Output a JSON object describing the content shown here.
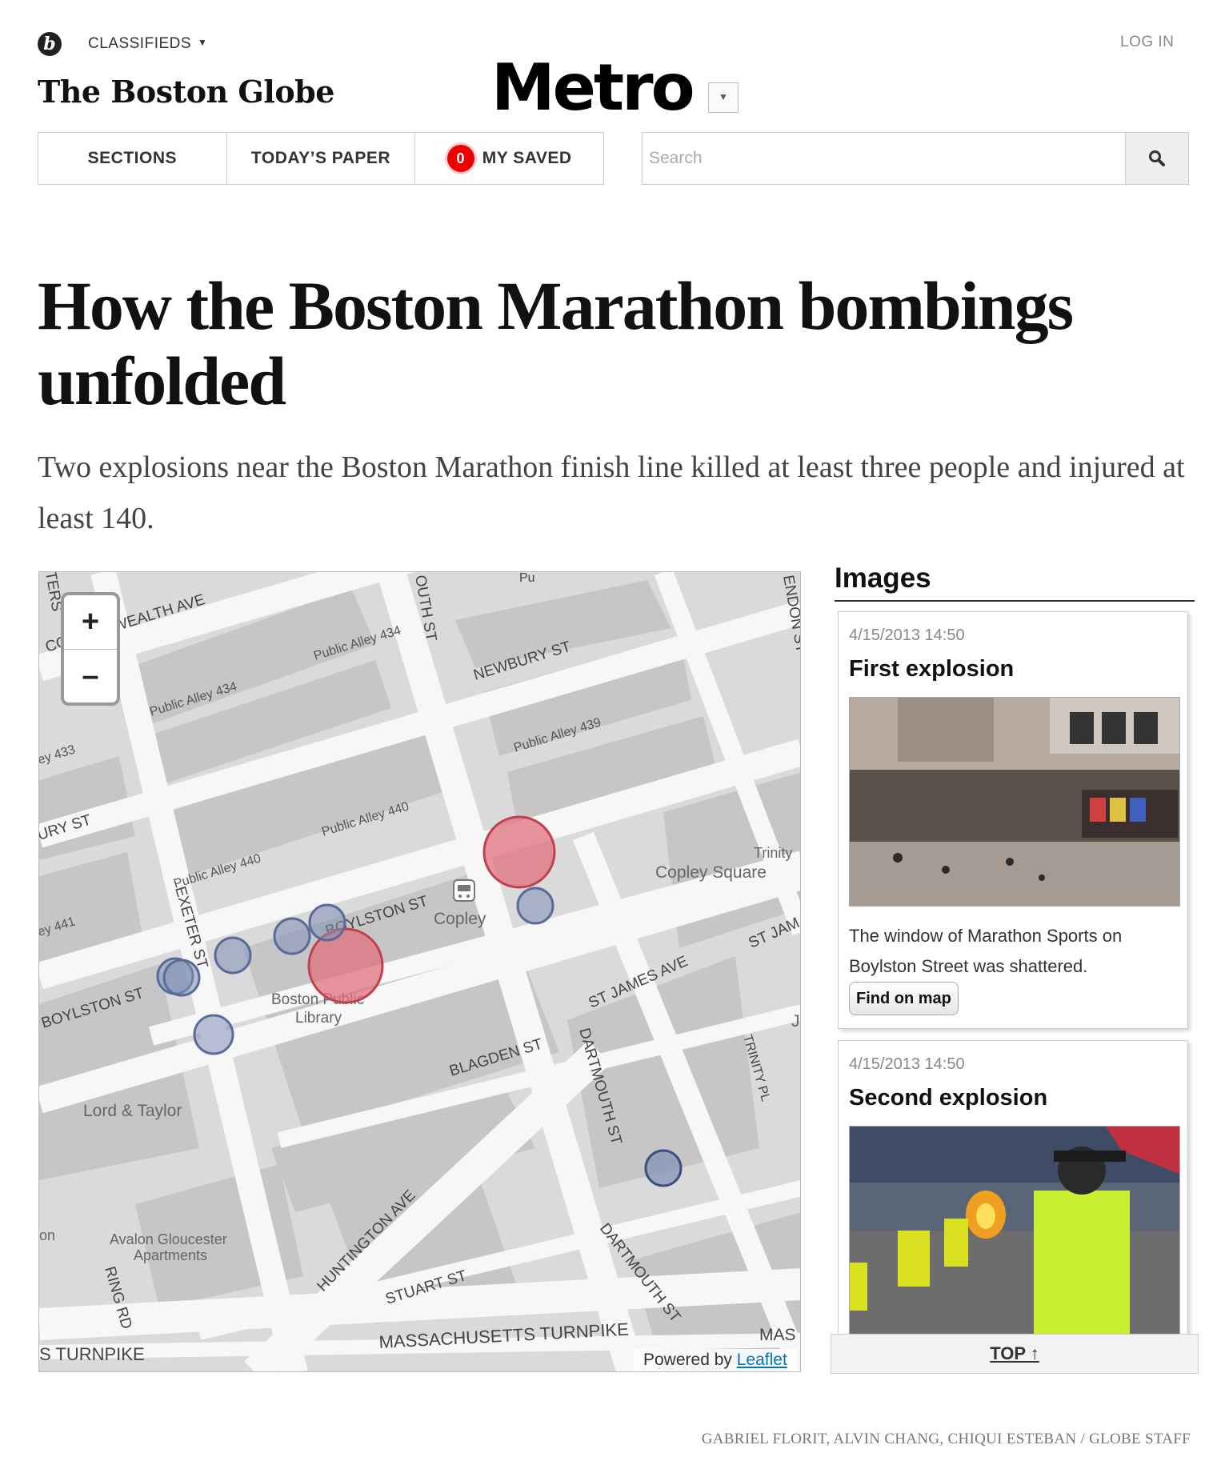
{
  "header": {
    "classifieds_label": "CLASSIFIEDS",
    "login_label": "LOG IN",
    "masthead": "The Boston Globe",
    "section_title": "Metro"
  },
  "nav": {
    "sections_label": "SECTIONS",
    "todays_paper_label": "TODAY’S PAPER",
    "saved_count": "0",
    "saved_label": "MY SAVED"
  },
  "search": {
    "placeholder": "Search"
  },
  "article": {
    "headline": "How the Boston Marathon bombings unfolded",
    "dek": "Two explosions near the Boston Marathon finish line killed at least three people and injured at least 140."
  },
  "map": {
    "zoom_in": "+",
    "zoom_out": "–",
    "attribution_prefix": "Powered by",
    "attribution_link": "Leaflet",
    "labels": {
      "commonwealth": "COMMONWEALTH AVE",
      "newbury": "NEWBURY ST",
      "newbury_left": "URY ST",
      "boylston1": "BOYLSTON ST",
      "boylston2": "BOYLSTON ST",
      "st_james": "ST JAMES AVE",
      "st_jam": "ST JAM",
      "blagden": "BLAGDEN ST",
      "exeter": "EXETER ST",
      "dartmouth1": "DARTMOUTH ST",
      "dartmouth2": "DARTMOUTH ST",
      "trinity_pl": "TRINITY PL",
      "huntington": "HUNTINGTON AVE",
      "stuart": "STUART ST",
      "mass_turnpike": "MASSACHUSETTS TURNPIKE",
      "s_turnpike": "S TURNPIKE",
      "ring_rd": "RING RD",
      "mas": "MAS",
      "south_st": "OUTH ST",
      "endon": "ENDON ST",
      "ters": "TERS",
      "alley434a": "Public Alley 434",
      "alley434b": "Public Alley 434",
      "alley439": "Public Alley 439",
      "alley440a": "Public Alley 440",
      "alley440b": "Public Alley 440",
      "alley433": "ey 433",
      "alley441": "ey 441",
      "copley": "Copley",
      "copley_square": "Copley Square",
      "trinity": "Trinity",
      "bpl1": "Boston Public",
      "bpl2": "Library",
      "lord_taylor": "Lord & Taylor",
      "avalon1": "Avalon Gloucester",
      "avalon2": "Apartments",
      "pu": "Pu",
      "on": "on",
      "jo": "Jo"
    },
    "colors": {
      "explosion": "#e0707f",
      "marker": "#7f8fb5"
    }
  },
  "sidebar": {
    "heading": "Images",
    "cards": [
      {
        "time": "4/15/2013 14:50",
        "title": "First explosion",
        "caption": "The window of Marathon Sports on Boylston Street was shattered.",
        "button": "Find on map"
      },
      {
        "time": "4/15/2013 14:50",
        "title": "Second explosion"
      }
    ],
    "top_label": "TOP ↑"
  },
  "credit": "GABRIEL FLORIT, ALVIN CHANG, CHIQUI ESTEBAN / GLOBE STAFF"
}
